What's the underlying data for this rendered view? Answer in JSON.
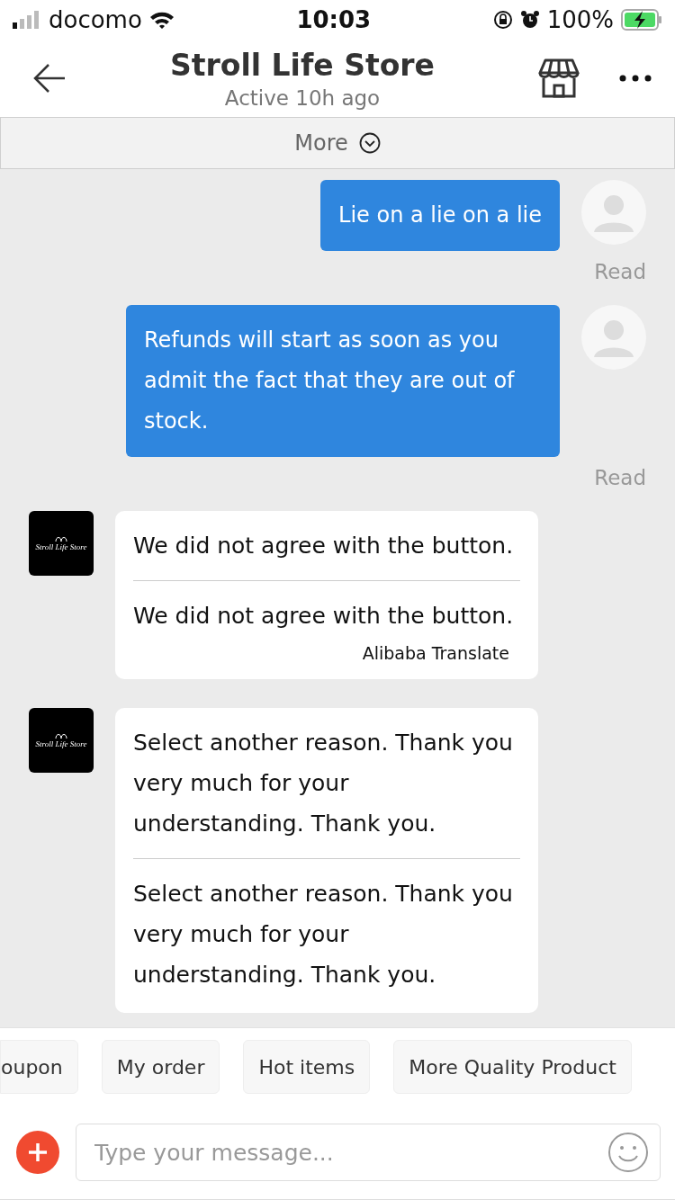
{
  "status_bar": {
    "carrier": "docomo",
    "time": "10:03",
    "battery": "100%"
  },
  "header": {
    "title": "Stroll Life Store",
    "subtitle": "Active 10h ago"
  },
  "more_bar": {
    "label": "More"
  },
  "messages": [
    {
      "kind": "sent",
      "text": "Lie on a lie on a lie",
      "status": "Read"
    },
    {
      "kind": "sent",
      "text": "Refunds will start as soon as you admit the fact that they are out of stock.",
      "status": "Read"
    },
    {
      "kind": "received",
      "logo_text": "Stroll Life Store",
      "text": "We did not agree with the button.",
      "translation": "We did not agree with the button.",
      "translator": "Alibaba Translate"
    },
    {
      "kind": "received",
      "logo_text": "Stroll Life Store",
      "text": "Select another reason. Thank you very much for your understanding. Thank you.",
      "translation": "Select another reason. Thank you very much for your understanding. Thank you."
    }
  ],
  "quick_replies": [
    "oupon",
    "My order",
    "Hot items",
    "More Quality Product"
  ],
  "composer": {
    "placeholder": "Type your message..."
  }
}
